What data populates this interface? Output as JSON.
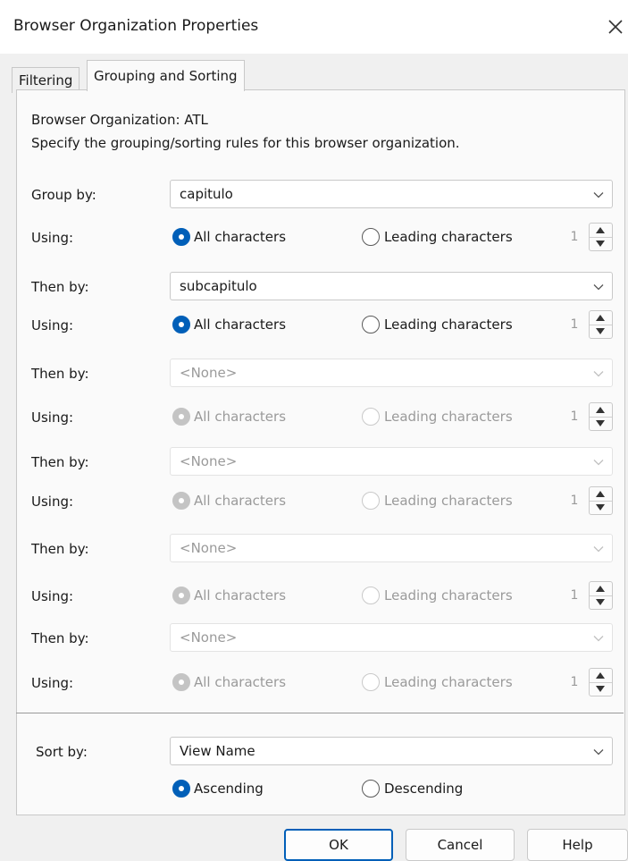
{
  "window": {
    "title": "Browser Organization Properties"
  },
  "tabs": [
    {
      "label": "Filtering"
    },
    {
      "label": "Grouping and Sorting"
    }
  ],
  "header": {
    "org_line": "Browser Organization: ATL",
    "instructions": "Specify the grouping/sorting rules for this browser organization."
  },
  "rows": [
    {
      "label": "Group by:",
      "value": "capitulo",
      "using_label": "Using:",
      "opt_all": "All characters",
      "opt_leading": "Leading characters",
      "count": "1",
      "selected": "all",
      "enabled": true
    },
    {
      "label": "Then by:",
      "value": "subcapitulo",
      "using_label": "Using:",
      "opt_all": "All characters",
      "opt_leading": "Leading characters",
      "count": "1",
      "selected": "all",
      "enabled": true
    },
    {
      "label": "Then by:",
      "value": "<None>",
      "using_label": "Using:",
      "opt_all": "All characters",
      "opt_leading": "Leading characters",
      "count": "1",
      "selected": "all",
      "enabled": false
    },
    {
      "label": "Then by:",
      "value": "<None>",
      "using_label": "Using:",
      "opt_all": "All characters",
      "opt_leading": "Leading characters",
      "count": "1",
      "selected": "all",
      "enabled": false
    },
    {
      "label": "Then by:",
      "value": "<None>",
      "using_label": "Using:",
      "opt_all": "All characters",
      "opt_leading": "Leading characters",
      "count": "1",
      "selected": "all",
      "enabled": false
    },
    {
      "label": "Then by:",
      "value": "<None>",
      "using_label": "Using:",
      "opt_all": "All characters",
      "opt_leading": "Leading characters",
      "count": "1",
      "selected": "all",
      "enabled": false
    }
  ],
  "sort": {
    "label": "Sort by:",
    "value": "View Name",
    "ascending": "Ascending",
    "descending": "Descending",
    "selected": "ascending"
  },
  "buttons": {
    "ok": "OK",
    "cancel": "Cancel",
    "help": "Help"
  },
  "colors": {
    "accent": "#005fb8",
    "disabled": "#9a9a9a",
    "background": "#f0f0f0"
  },
  "icons": {
    "close": "close-icon",
    "dropdown": "chevron-down-icon",
    "spin_up": "spin-up-icon",
    "spin_down": "spin-down-icon"
  }
}
